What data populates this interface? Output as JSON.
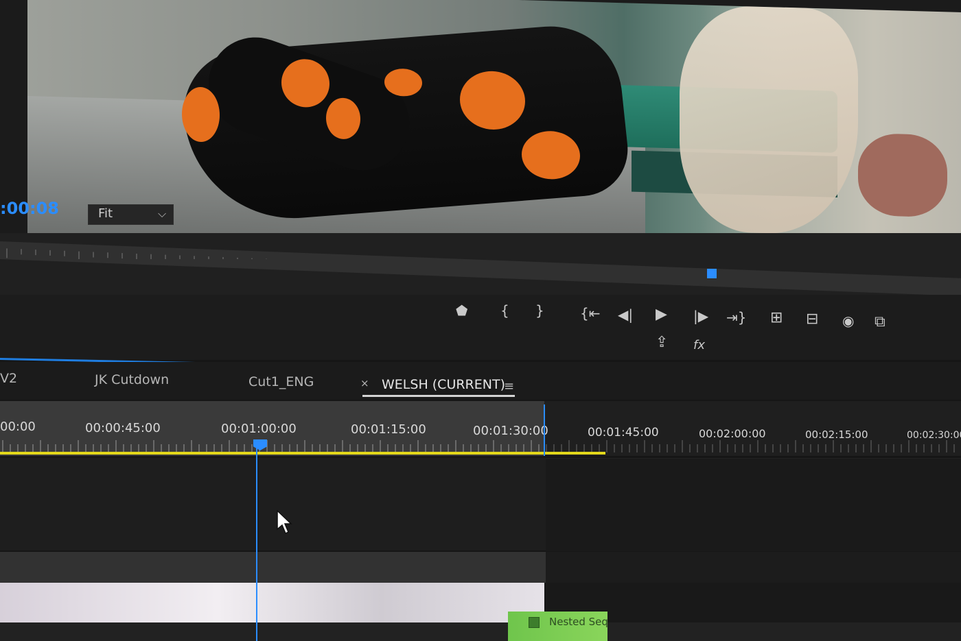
{
  "monitor": {
    "timecode": ":00:08",
    "zoom": "Fit",
    "zoom_chevron": "chevron-down-icon"
  },
  "transport": {
    "buttons": [
      {
        "name": "add-marker-icon",
        "glyph": "⬟"
      },
      {
        "name": "mark-in-icon",
        "glyph": "{"
      },
      {
        "name": "mark-out-icon",
        "glyph": "}"
      },
      {
        "name": "go-to-in-icon",
        "glyph": "{⇤"
      },
      {
        "name": "step-back-icon",
        "glyph": "◀|"
      },
      {
        "name": "play-icon",
        "glyph": "▶"
      },
      {
        "name": "step-forward-icon",
        "glyph": "|▶"
      },
      {
        "name": "go-to-out-icon",
        "glyph": "⇥}"
      },
      {
        "name": "lift-icon",
        "glyph": "⊞"
      },
      {
        "name": "extract-icon",
        "glyph": "⊟"
      },
      {
        "name": "export-frame-icon",
        "glyph": "◉"
      },
      {
        "name": "comparison-view-icon",
        "glyph": "⧉"
      },
      {
        "name": "export-icon",
        "glyph": "⇪"
      },
      {
        "name": "fx-icon",
        "glyph": "fx"
      }
    ]
  },
  "timeline": {
    "tabs": [
      {
        "label": "V2"
      },
      {
        "label": "JK Cutdown"
      },
      {
        "label": "Cut1_ENG"
      },
      {
        "label": "WELSH (CURRENT)",
        "close": "×",
        "menu": "≡",
        "active": true
      }
    ],
    "ruler_labels": [
      "00:00",
      "00:00:45:00",
      "00:01:00:00",
      "00:01:15:00",
      "00:01:30:00",
      "00:01:45:00",
      "00:02:00:00",
      "00:02:15:00",
      "00:02:30:00"
    ],
    "playhead_time": "00:01:00:00",
    "clip": {
      "label": "Nested Seq",
      "color": "#7acd52",
      "icon": "fx-badge-icon"
    },
    "accent": "#2b8dff",
    "work_area_color": "#e3d81b"
  }
}
